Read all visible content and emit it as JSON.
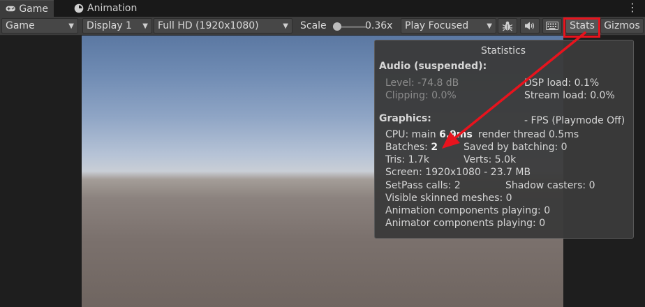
{
  "tabs": [
    {
      "label": "Game",
      "icon": "gamepad-icon",
      "active": true
    },
    {
      "label": "Animation",
      "icon": "clock-icon",
      "active": false
    }
  ],
  "toolbar": {
    "view_mode": "Game",
    "display": "Display 1",
    "resolution": "Full HD (1920x1080)",
    "scale_label": "Scale",
    "scale_value": "0.36x",
    "play_mode": "Play Focused",
    "stats_label": "Stats",
    "gizmos_label": "Gizmos"
  },
  "stats": {
    "title": "Statistics",
    "audio_heading": "Audio (suspended):",
    "audio_level": "Level: -74.8 dB",
    "audio_clipping": "Clipping: 0.0%",
    "dsp_load": "DSP load: 0.1%",
    "stream_load": "Stream load: 0.0%",
    "graphics_heading": "Graphics:",
    "fps": "- FPS (Playmode Off)",
    "cpu_prefix": "CPU: main",
    "cpu_main_value": "6.9ms",
    "cpu_render": "render thread 0.5ms",
    "batches_prefix": "Batches:",
    "batches_value": "2",
    "saved_by_batching": "Saved by batching: 0",
    "tris": "Tris: 1.7k",
    "verts": "Verts: 5.0k",
    "screen": "Screen: 1920x1080 - 23.7 MB",
    "setpass": "SetPass calls: 2",
    "shadow_casters": "Shadow casters: 0",
    "skinned": "Visible skinned meshes: 0",
    "animation_components": "Animation components playing: 0",
    "animator_components": "Animator components playing: 0"
  },
  "annotation": {
    "color": "#e8131d"
  }
}
